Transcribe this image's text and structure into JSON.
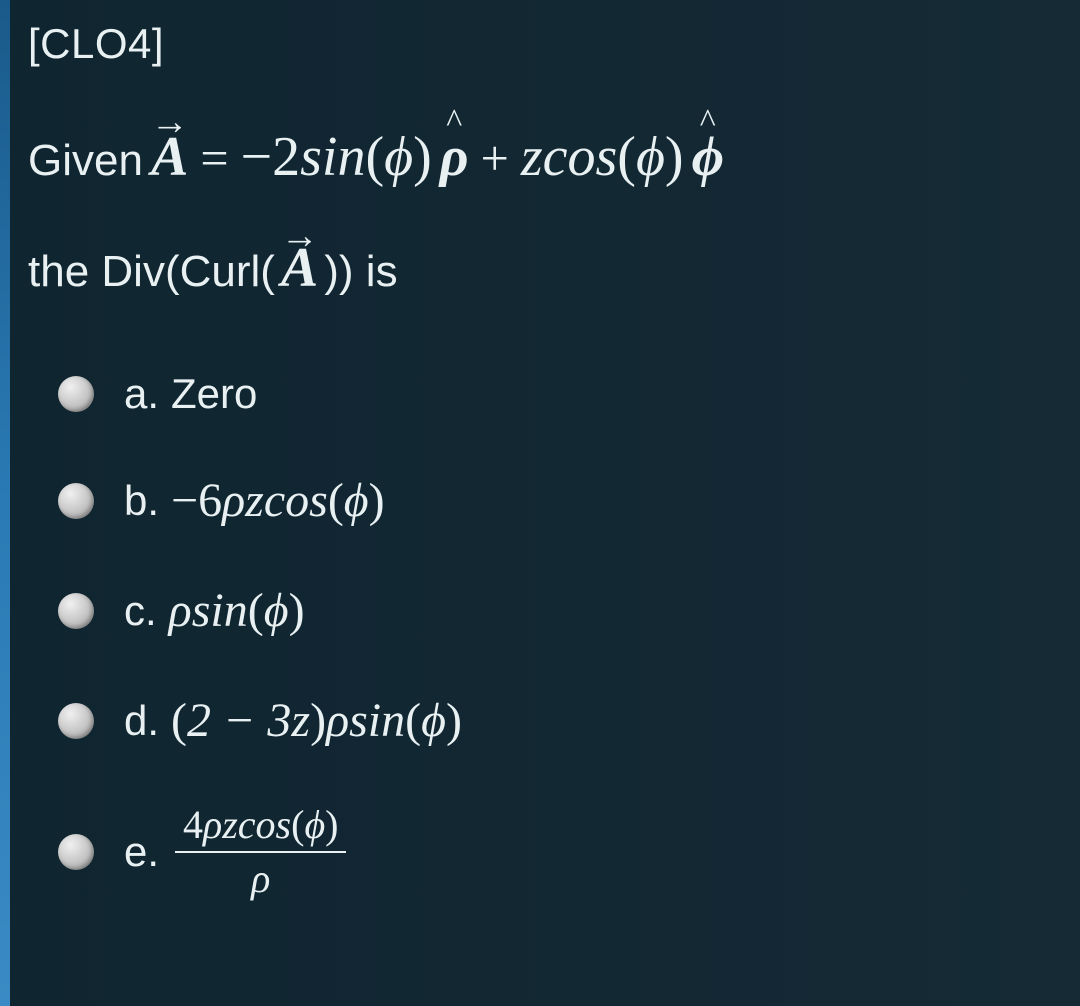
{
  "tag": "[CLO4]",
  "question": {
    "prefix": "Given",
    "vector": "A",
    "equals": "=",
    "term1_coef": "−2",
    "term1_func": "sin",
    "term1_arg": "ϕ",
    "term1_hat": "ρ",
    "plus": "+",
    "term2_var": "z",
    "term2_func": "cos",
    "term2_arg": "ϕ",
    "term2_hat": "ϕ",
    "line2_prefix": "the Div(Curl(",
    "line2_vector": "A",
    "line2_suffix": ")) is"
  },
  "options": [
    {
      "letter": "a.",
      "plain": "Zero",
      "type": "plain"
    },
    {
      "letter": "b.",
      "expr_prefix": "−6",
      "expr_vars": "ρz",
      "expr_func": "cos",
      "expr_arg": "ϕ",
      "type": "trig"
    },
    {
      "letter": "c.",
      "expr_prefix": "",
      "expr_vars": "ρ",
      "expr_func": "sin",
      "expr_arg": "ϕ",
      "type": "trig"
    },
    {
      "letter": "d.",
      "paren_inner": "2 − 3z",
      "expr_vars": "ρ",
      "expr_func": "sin",
      "expr_arg": "ϕ",
      "type": "paren_trig"
    },
    {
      "letter": "e.",
      "num_coef": "4",
      "num_vars": "ρz",
      "num_func": "cos",
      "num_arg": "ϕ",
      "den": "ρ",
      "type": "frac"
    }
  ]
}
